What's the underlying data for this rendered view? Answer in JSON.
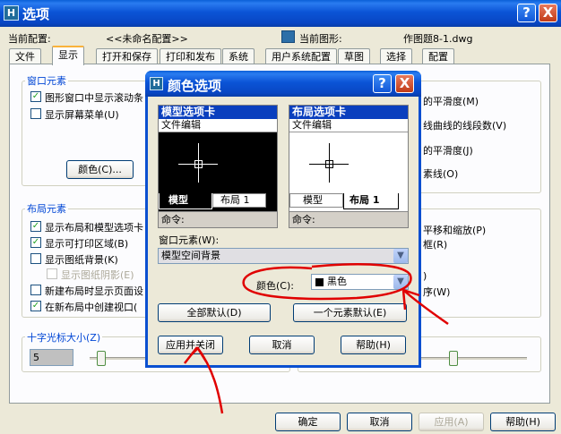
{
  "main_window": {
    "title": "选项",
    "current_config_label": "当前配置:",
    "current_config_value": "<<未命名配置>>",
    "current_drawing_label": "当前图形:",
    "current_drawing_value": "作图题8-1.dwg",
    "help_button": "?",
    "close_button": "X"
  },
  "tabs": [
    "文件",
    "显示",
    "打开和保存",
    "打印和发布",
    "系统",
    "用户系统配置",
    "草图",
    "选择",
    "配置"
  ],
  "window_elements": {
    "group_label": "窗口元素",
    "items": [
      {
        "label": "图形窗口中显示滚动条",
        "checked": true
      },
      {
        "label": "显示屏幕菜单(U)",
        "checked": false
      }
    ],
    "color_button": "颜色(C)..."
  },
  "layout_elements": {
    "group_label": "布局元素",
    "items": [
      {
        "label": "显示布局和模型选项卡",
        "checked": true
      },
      {
        "label": "显示可打印区域(B)",
        "checked": true
      },
      {
        "label": "显示图纸背景(K)",
        "checked": false
      },
      {
        "label": "显示图纸阴影(E)",
        "checked": false,
        "disabled": true
      },
      {
        "label": "新建布局时显示页面设",
        "checked": false
      },
      {
        "label": "在新布局中创建视口(",
        "checked": true
      }
    ]
  },
  "crosshair": {
    "group_label": "十字光标大小(Z)",
    "value": "5"
  },
  "right_fragments": [
    "的平滑度(M)",
    "线曲线的线段数(V)",
    "的平滑度(J)",
    "素线(O)",
    "平移和缩放(P)",
    "框(R)",
    ")",
    "序(W)"
  ],
  "bottom_buttons": {
    "ok": "确定",
    "cancel": "取消",
    "apply": "应用(A)",
    "help": "帮助(H)"
  },
  "color_dialog": {
    "title": "颜色选项",
    "help_button": "?",
    "close_button": "X",
    "model_preview": {
      "title": "模型选项卡",
      "menu": "文件编辑",
      "tab_model": "模型",
      "tab_layout": "布局 1",
      "command": "命令:"
    },
    "layout_preview": {
      "title": "布局选项卡",
      "menu": "文件编辑",
      "tab_model": "模型",
      "tab_layout": "布局 1",
      "command": "命令:"
    },
    "window_element_label": "窗口元素(W):",
    "window_element_value": "模型空间背景",
    "color_label": "颜色(C):",
    "color_value": "黑色",
    "color_swatch": "#000000",
    "restore_all_button": "全部默认(D)",
    "restore_one_button": "一个元素默认(E)",
    "apply_close_button": "应用并关闭",
    "cancel_button": "取消",
    "help_button_text": "帮助(H)"
  },
  "annotation_color": "#e00000"
}
